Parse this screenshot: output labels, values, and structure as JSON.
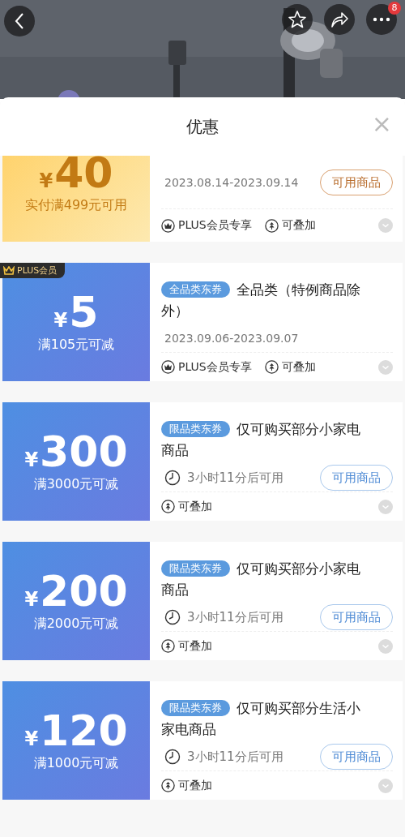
{
  "top_bar": {
    "badge": "8"
  },
  "sheet": {
    "title": "优惠",
    "close": "×"
  },
  "coupons": [
    {
      "kind": "gold",
      "currency": "¥",
      "amount": "40",
      "condition": "实付满499元可用",
      "validity": {
        "kind": "dates",
        "text": "2023.08.14-2023.09.14"
      },
      "button": "可用商品",
      "perks": [
        {
          "kind": "plus",
          "text": "PLUS会员专享"
        },
        {
          "kind": "stack",
          "text": "可叠加"
        }
      ]
    },
    {
      "kind": "blue",
      "plus_badge": "PLUS会员",
      "currency": "¥",
      "amount": "5",
      "condition": "满105元可减",
      "tag": "全品类东券",
      "title": "全品类（特例商品除外）",
      "validity": {
        "kind": "dates",
        "text": "2023.09.06-2023.09.07"
      },
      "perks": [
        {
          "kind": "plus",
          "text": "PLUS会员专享"
        },
        {
          "kind": "stack",
          "text": "可叠加"
        }
      ]
    },
    {
      "kind": "blue",
      "currency": "¥",
      "amount": "300",
      "condition": "满3000元可减",
      "tag": "限品类东券",
      "title": "仅可购买部分小家电商品",
      "validity": {
        "kind": "countdown",
        "text": "3小时11分后可用"
      },
      "button": "可用商品",
      "perks": [
        {
          "kind": "stack",
          "text": "可叠加"
        }
      ]
    },
    {
      "kind": "blue",
      "currency": "¥",
      "amount": "200",
      "condition": "满2000元可减",
      "tag": "限品类东券",
      "title": "仅可购买部分小家电商品",
      "validity": {
        "kind": "countdown",
        "text": "3小时11分后可用"
      },
      "button": "可用商品",
      "perks": [
        {
          "kind": "stack",
          "text": "可叠加"
        }
      ]
    },
    {
      "kind": "blue",
      "currency": "¥",
      "amount": "120",
      "condition": "满1000元可减",
      "tag": "限品类东券",
      "title": "仅可购买部分生活小家电商品",
      "validity": {
        "kind": "countdown",
        "text": "3小时11分后可用"
      },
      "button": "可用商品",
      "perks": [
        {
          "kind": "stack",
          "text": "可叠加"
        }
      ]
    }
  ]
}
